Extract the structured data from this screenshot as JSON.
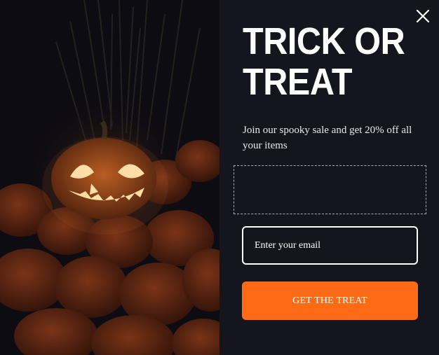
{
  "popup": {
    "headline": "TRICK OR TREAT",
    "subtext": "Join our spooky sale and get 20% off all your items",
    "email_placeholder": "Enter your email",
    "cta_label": "GET THE TREAT",
    "close_icon": "close-icon",
    "image_description": "jack-o-lantern-image"
  },
  "colors": {
    "panel_bg": "#15151d",
    "accent": "#ff6a14",
    "text": "#ffffff"
  }
}
